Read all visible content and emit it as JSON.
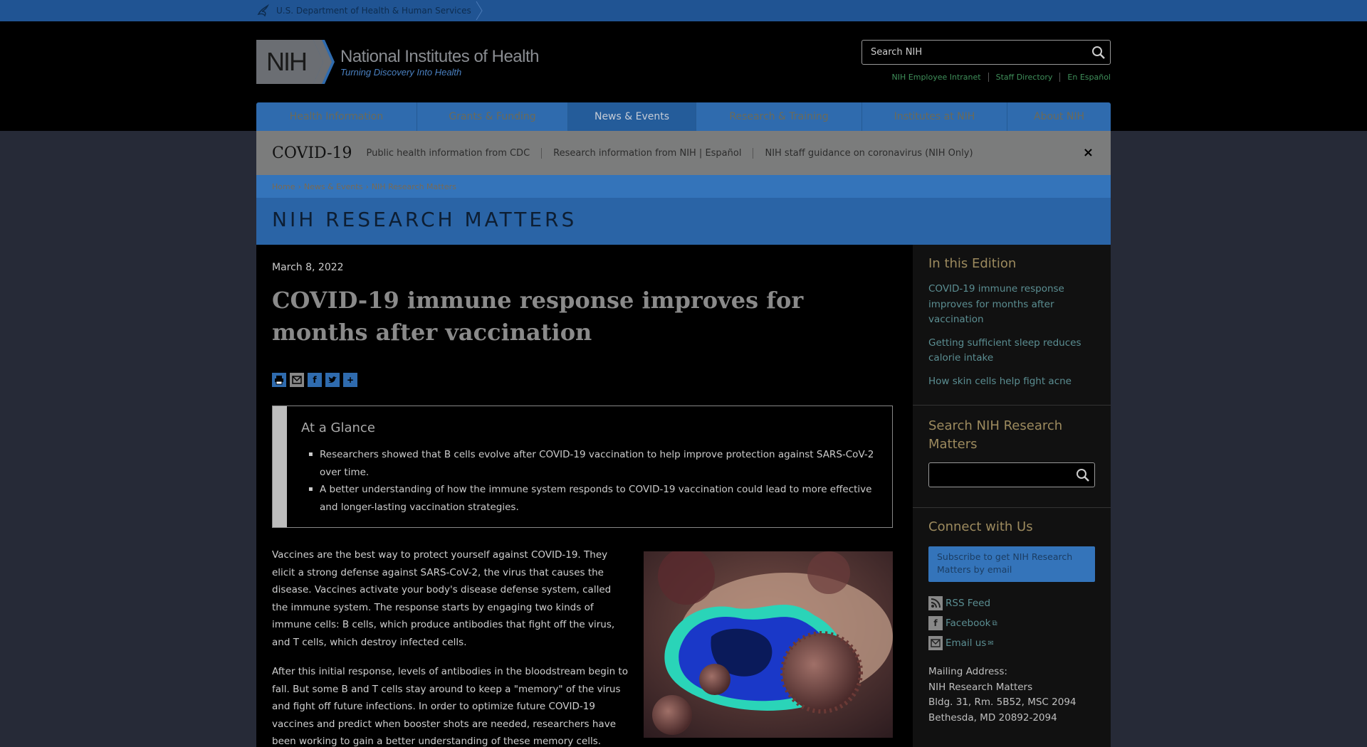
{
  "hhs": {
    "label": "U.S. Department of Health & Human Services"
  },
  "header": {
    "logo_mark": "NIH",
    "logo_title": "National Institutes of Health",
    "logo_subtitle": "Turning Discovery Into Health",
    "search_placeholder": "Search NIH",
    "util_links": [
      "NIH Employee Intranet",
      "Staff Directory",
      "En Español"
    ]
  },
  "nav": {
    "items": [
      {
        "label": "Health Information",
        "active": false
      },
      {
        "label": "Grants & Funding",
        "active": false
      },
      {
        "label": "News & Events",
        "active": true
      },
      {
        "label": "Research & Training",
        "active": false
      },
      {
        "label": "Institutes at NIH",
        "active": false
      },
      {
        "label": "About NIH",
        "active": false
      }
    ]
  },
  "covid": {
    "title": "COVID-19",
    "links": [
      "Public health information from CDC",
      "Research information from NIH | Español",
      "NIH staff guidance on coronavirus (NIH Only)"
    ],
    "close": "×"
  },
  "breadcrumb": [
    "Home",
    "News & Events",
    "NIH Research Matters"
  ],
  "banner": {
    "title": "NIH RESEARCH MATTERS"
  },
  "article": {
    "date": "March 8, 2022",
    "title": "COVID-19 immune response improves for months after vaccination",
    "glance_title": "At a Glance",
    "glance_items": [
      "Researchers showed that B cells evolve after COVID-19 vaccination to help improve protection against SARS-CoV-2 over time.",
      "A better understanding of how the immune system responds to COVID-19 vaccination could lead to more effective and longer-lasting vaccination strategies."
    ],
    "p1": "Vaccines are the best way to protect yourself against COVID-19. They elicit a strong defense against SARS-CoV-2, the virus that causes the disease. Vaccines activate your body's disease defense system, called the immune system. The response starts by engaging two kinds of immune cells: B cells, which produce antibodies that fight off the virus, and T cells, which destroy infected cells.",
    "p2": "After this initial response, levels of antibodies in the bloodstream begin to fall. But some B and T cells stay around to keep a \"memory\" of the virus and fight off future infections. In order to optimize future COVID-19 vaccines and predict when booster shots are needed, researchers have been working to gain a better understanding of these memory cells."
  },
  "sidebar": {
    "edition_heading": "In this Edition",
    "edition_links": [
      "COVID-19 immune response improves for months after vaccination",
      "Getting sufficient sleep reduces calorie intake",
      "How skin cells help fight acne"
    ],
    "search_heading": "Search NIH Research Matters",
    "connect_heading": "Connect with Us",
    "subscribe": "Subscribe to get NIH Research Matters by email",
    "social": [
      "RSS Feed",
      "Facebook",
      "Email us"
    ],
    "mailing_label": "Mailing Address:",
    "mailing_lines": [
      "NIH Research Matters",
      "Bldg. 31, Rm. 5B52, MSC 2094",
      "Bethesda, MD 20892-2094"
    ]
  }
}
